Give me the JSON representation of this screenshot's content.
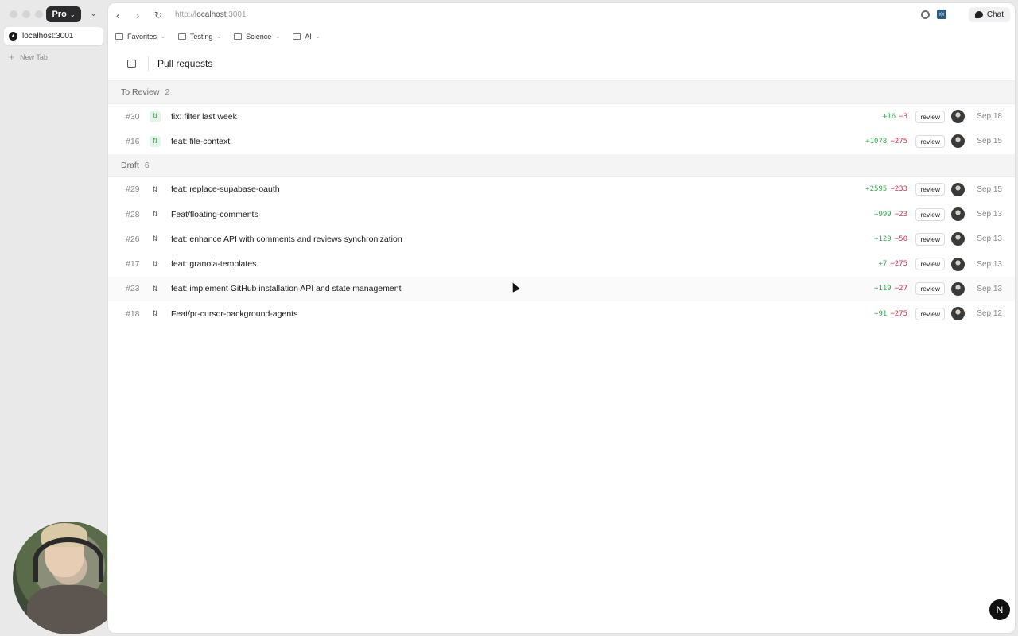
{
  "browser": {
    "profile_label": "Pro",
    "active_tab_title": "localhost:3001",
    "new_tab_label": "New Tab",
    "url_scheme": "http://",
    "url_host": "localhost",
    "url_port": ":3001",
    "chat_label": "Chat",
    "bookmarks": [
      {
        "label": "Favorites"
      },
      {
        "label": "Testing"
      },
      {
        "label": "Science"
      },
      {
        "label": "AI"
      }
    ]
  },
  "page": {
    "title": "Pull requests",
    "badge": "N"
  },
  "groups": [
    {
      "name": "To Review",
      "count": "2",
      "rows": [
        {
          "num": "#30",
          "title": "fix: filter last week",
          "add": "+16",
          "del": "−3",
          "review": "review",
          "date": "Sep 18",
          "state": "open"
        },
        {
          "num": "#16",
          "title": "feat: file-context",
          "add": "+1078",
          "del": "−275",
          "review": "review",
          "date": "Sep 15",
          "state": "open"
        }
      ]
    },
    {
      "name": "Draft",
      "count": "6",
      "rows": [
        {
          "num": "#29",
          "title": "feat: replace-supabase-oauth",
          "add": "+2595",
          "del": "−233",
          "review": "review",
          "date": "Sep 15",
          "state": "draft"
        },
        {
          "num": "#28",
          "title": "Feat/floating-comments",
          "add": "+999",
          "del": "−23",
          "review": "review",
          "date": "Sep 13",
          "state": "draft"
        },
        {
          "num": "#26",
          "title": "feat: enhance API with comments and reviews synchronization",
          "add": "+129",
          "del": "−50",
          "review": "review",
          "date": "Sep 13",
          "state": "draft"
        },
        {
          "num": "#17",
          "title": "feat: granola-templates",
          "add": "+7",
          "del": "−275",
          "review": "review",
          "date": "Sep 13",
          "state": "draft"
        },
        {
          "num": "#23",
          "title": "feat: implement GitHub installation API and state management",
          "add": "+119",
          "del": "−27",
          "review": "review",
          "date": "Sep 13",
          "state": "draft"
        },
        {
          "num": "#18",
          "title": "Feat/pr-cursor-background-agents",
          "add": "+91",
          "del": "−275",
          "review": "review",
          "date": "Sep 12",
          "state": "draft"
        }
      ]
    }
  ]
}
